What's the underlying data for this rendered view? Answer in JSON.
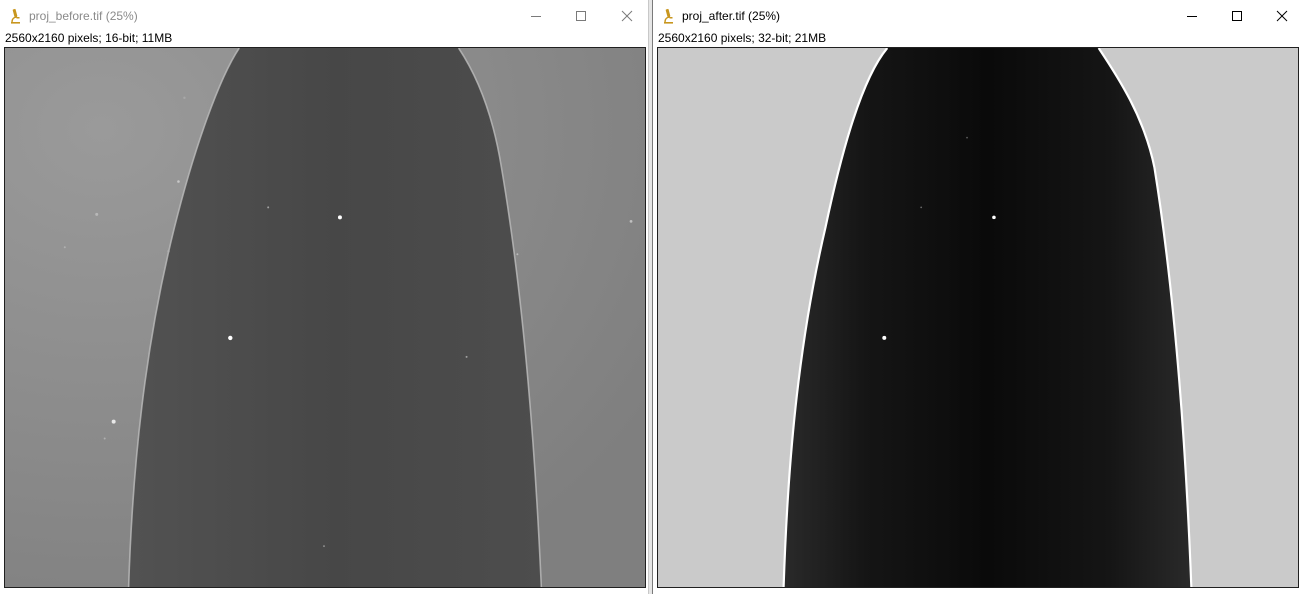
{
  "windows": [
    {
      "title": "proj_before.tif (25%)",
      "info": "2560x2160 pixels; 16-bit; 11MB",
      "icon": "microscope-icon",
      "active": false,
      "image": {
        "background_color": "#8a8a8a",
        "specimen_color": "#4a4a4a",
        "edge_color": "#d0d0d0"
      }
    },
    {
      "title": "proj_after.tif (25%)",
      "info": "2560x2160 pixels; 32-bit; 21MB",
      "icon": "microscope-icon",
      "active": true,
      "image": {
        "background_color": "#c9c9c9",
        "specimen_color": "#151515",
        "edge_color": "#ffffff"
      }
    }
  ],
  "caption_buttons": {
    "minimize": "minimize-icon",
    "maximize": "maximize-icon",
    "close": "close-icon"
  },
  "colors": {
    "icon_accent": "#c8961e",
    "inactive_title": "#8a8a8a",
    "active_title": "#000000"
  }
}
